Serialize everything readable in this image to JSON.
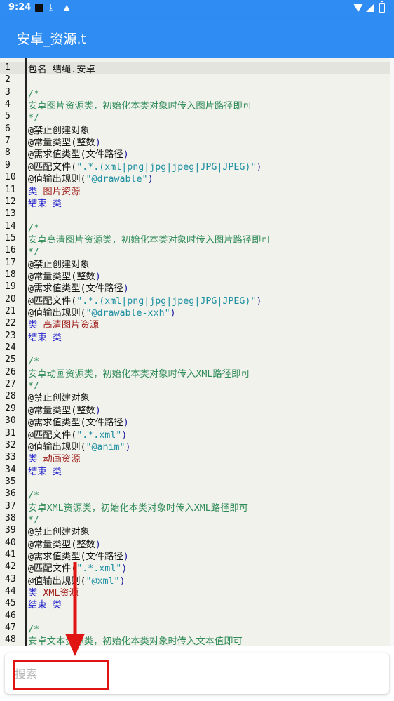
{
  "status_bar": {
    "time": "9:24"
  },
  "app_bar": {
    "title": "安卓_资源.t"
  },
  "search": {
    "placeholder": "搜索"
  },
  "editor": {
    "lines": [
      [
        [
          "包名 结绳.安卓",
          "#111111"
        ]
      ],
      [],
      [
        [
          "/*",
          "#2e8b57"
        ]
      ],
      [
        [
          "安卓图片资源类，初始化本类对象时传入图片路径即可",
          "#2e8b57"
        ]
      ],
      [
        [
          "*/",
          "#2e8b57"
        ]
      ],
      [
        [
          "@禁止创建对象",
          "#111111"
        ]
      ],
      [
        [
          "@常量类型(",
          "#111111"
        ],
        [
          "整数",
          "#111111"
        ],
        [
          ")",
          "#1e1ea0"
        ]
      ],
      [
        [
          "@需求值类型(",
          "#111111"
        ],
        [
          "文件路径",
          "#111111"
        ],
        [
          ")",
          "#1e1ea0"
        ]
      ],
      [
        [
          "@匹配文件(",
          "#111111"
        ],
        [
          "\".*.(xml|png|jpg|jpeg|JPG|JPEG)\"",
          "#1c8fa0"
        ],
        [
          ")",
          "#1e1ea0"
        ]
      ],
      [
        [
          "@值输出规则(",
          "#111111"
        ],
        [
          "\"@drawable\"",
          "#1c8fa0"
        ],
        [
          ")",
          "#1e1ea0"
        ]
      ],
      [
        [
          "类 ",
          "#2222cc"
        ],
        [
          "图片资源",
          "#a0201c"
        ]
      ],
      [
        [
          "结束 类",
          "#2222cc"
        ]
      ],
      [],
      [
        [
          "/*",
          "#2e8b57"
        ]
      ],
      [
        [
          "安卓高清图片资源类，初始化本类对象时传入图片路径即可",
          "#2e8b57"
        ]
      ],
      [
        [
          "*/",
          "#2e8b57"
        ]
      ],
      [
        [
          "@禁止创建对象",
          "#111111"
        ]
      ],
      [
        [
          "@常量类型(",
          "#111111"
        ],
        [
          "整数",
          "#111111"
        ],
        [
          ")",
          "#1e1ea0"
        ]
      ],
      [
        [
          "@需求值类型(",
          "#111111"
        ],
        [
          "文件路径",
          "#111111"
        ],
        [
          ")",
          "#1e1ea0"
        ]
      ],
      [
        [
          "@匹配文件(",
          "#111111"
        ],
        [
          "\".*.(xml|png|jpg|jpeg|JPG|JPEG)\"",
          "#1c8fa0"
        ],
        [
          ")",
          "#1e1ea0"
        ]
      ],
      [
        [
          "@值输出规则(",
          "#111111"
        ],
        [
          "\"@drawable-xxh\"",
          "#1c8fa0"
        ],
        [
          ")",
          "#1e1ea0"
        ]
      ],
      [
        [
          "类 ",
          "#2222cc"
        ],
        [
          "高清图片资源",
          "#a0201c"
        ]
      ],
      [
        [
          "结束 类",
          "#2222cc"
        ]
      ],
      [],
      [
        [
          "/*",
          "#2e8b57"
        ]
      ],
      [
        [
          "安卓动画资源类，初始化本类对象时传入XML路径即可",
          "#2e8b57"
        ]
      ],
      [
        [
          "*/",
          "#2e8b57"
        ]
      ],
      [
        [
          "@禁止创建对象",
          "#111111"
        ]
      ],
      [
        [
          "@常量类型(",
          "#111111"
        ],
        [
          "整数",
          "#111111"
        ],
        [
          ")",
          "#1e1ea0"
        ]
      ],
      [
        [
          "@需求值类型(",
          "#111111"
        ],
        [
          "文件路径",
          "#111111"
        ],
        [
          ")",
          "#1e1ea0"
        ]
      ],
      [
        [
          "@匹配文件(",
          "#111111"
        ],
        [
          "\".*.xml\"",
          "#1c8fa0"
        ],
        [
          ")",
          "#1e1ea0"
        ]
      ],
      [
        [
          "@值输出规则(",
          "#111111"
        ],
        [
          "\"@anim\"",
          "#1c8fa0"
        ],
        [
          ")",
          "#1e1ea0"
        ]
      ],
      [
        [
          "类 ",
          "#2222cc"
        ],
        [
          "动画资源",
          "#a0201c"
        ]
      ],
      [
        [
          "结束 类",
          "#2222cc"
        ]
      ],
      [],
      [
        [
          "/*",
          "#2e8b57"
        ]
      ],
      [
        [
          "安卓XML资源类，初始化本类对象时传入XML路径即可",
          "#2e8b57"
        ]
      ],
      [
        [
          "*/",
          "#2e8b57"
        ]
      ],
      [
        [
          "@禁止创建对象",
          "#111111"
        ]
      ],
      [
        [
          "@常量类型(",
          "#111111"
        ],
        [
          "整数",
          "#111111"
        ],
        [
          ")",
          "#1e1ea0"
        ]
      ],
      [
        [
          "@需求值类型(",
          "#111111"
        ],
        [
          "文件路径",
          "#111111"
        ],
        [
          ")",
          "#1e1ea0"
        ]
      ],
      [
        [
          "@匹配文件(",
          "#111111"
        ],
        [
          "\".*.xml\"",
          "#1c8fa0"
        ],
        [
          ")",
          "#1e1ea0"
        ]
      ],
      [
        [
          "@值输出规则(",
          "#111111"
        ],
        [
          "\"@xml\"",
          "#1c8fa0"
        ],
        [
          ")",
          "#1e1ea0"
        ]
      ],
      [
        [
          "类 ",
          "#2222cc"
        ],
        [
          "XML资源",
          "#a0201c"
        ]
      ],
      [
        [
          "结束 类",
          "#2222cc"
        ]
      ],
      [],
      [
        [
          "/*",
          "#2e8b57"
        ]
      ],
      [
        [
          "安卓文本资源类，初始化本类对象时传入文本值即可",
          "#2e8b57"
        ]
      ]
    ]
  },
  "colors": {
    "accent": "#2f8cf2",
    "annotation_red": "#e11414"
  }
}
